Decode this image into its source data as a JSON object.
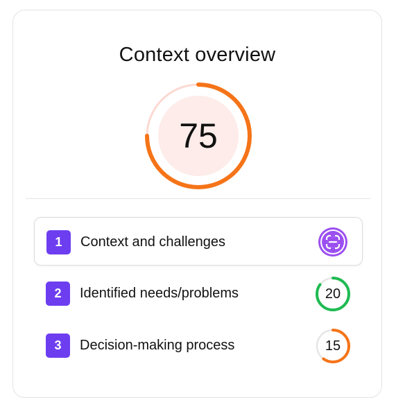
{
  "card": {
    "title": "Context overview",
    "score": {
      "value": "75",
      "progress": 0.75,
      "track_color": "#fcd9d2",
      "fill_color": "#f57418",
      "inner_color": "#fdece9"
    }
  },
  "sections": [
    {
      "number": "1",
      "label": "Context and challenges",
      "active": true,
      "status": {
        "type": "icon",
        "icon": "scan-frame-icon",
        "color": "#9b4ff0"
      }
    },
    {
      "number": "2",
      "label": "Identified needs/problems",
      "active": false,
      "status": {
        "type": "score",
        "value": "20",
        "progress": 0.85,
        "color": "#1fba52",
        "track_color": "#e6e6e6"
      }
    },
    {
      "number": "3",
      "label": "Decision-making process",
      "active": false,
      "status": {
        "type": "score",
        "value": "15",
        "progress": 0.6,
        "color": "#f57418",
        "track_color": "#e6e6e6"
      }
    }
  ],
  "colors": {
    "number_badge": "#6d3ef0",
    "border": "#e3e3e3"
  }
}
